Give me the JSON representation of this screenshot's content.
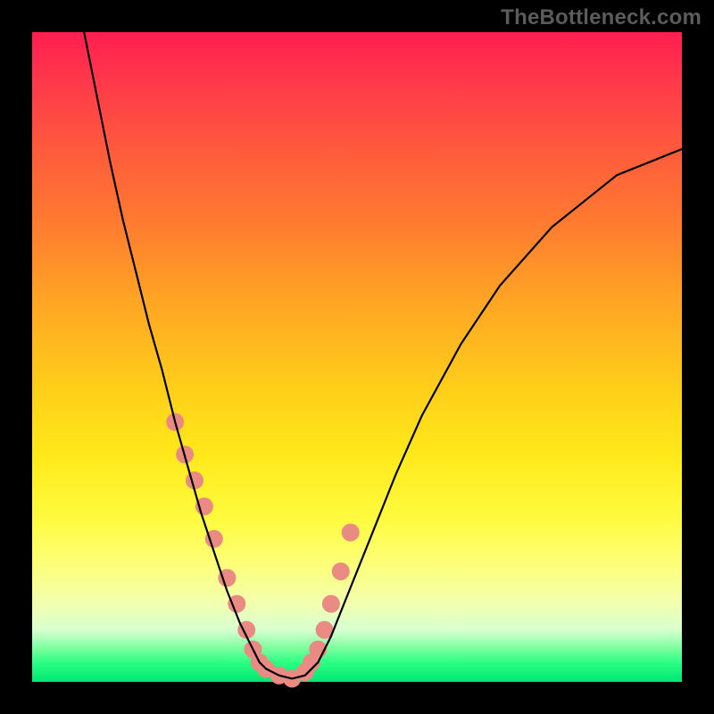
{
  "watermark": "TheBottleneck.com",
  "chart_data": {
    "type": "line",
    "title": "",
    "xlabel": "",
    "ylabel": "",
    "xlim": [
      0,
      100
    ],
    "ylim": [
      0,
      100
    ],
    "grid": false,
    "background": "gradient_red_to_green",
    "series": [
      {
        "name": "curve",
        "color": "#000000",
        "x": [
          8,
          10,
          12,
          14,
          16,
          18,
          20,
          22,
          24,
          26,
          28,
          30,
          32,
          34,
          35,
          36,
          38,
          40,
          42,
          44,
          46,
          48,
          52,
          56,
          60,
          66,
          72,
          80,
          90,
          100
        ],
        "y": [
          100,
          90,
          80,
          71,
          63,
          55,
          48,
          40,
          33,
          26,
          20,
          14,
          9,
          5,
          3,
          2,
          1,
          0.5,
          1,
          3,
          7,
          12,
          22,
          32,
          41,
          52,
          61,
          70,
          78,
          82
        ]
      }
    ],
    "markers": {
      "name": "highlighted-points",
      "color": "#e98a83",
      "radius_px": 10,
      "x": [
        22,
        23.5,
        25,
        26.5,
        28,
        30,
        31.5,
        33,
        34,
        35,
        36,
        38,
        40,
        42,
        43,
        44,
        45,
        46,
        47.5,
        49
      ],
      "y": [
        40,
        35,
        31,
        27,
        22,
        16,
        12,
        8,
        5,
        3,
        2,
        1,
        0.5,
        1.5,
        3,
        5,
        8,
        12,
        17,
        23
      ]
    }
  }
}
